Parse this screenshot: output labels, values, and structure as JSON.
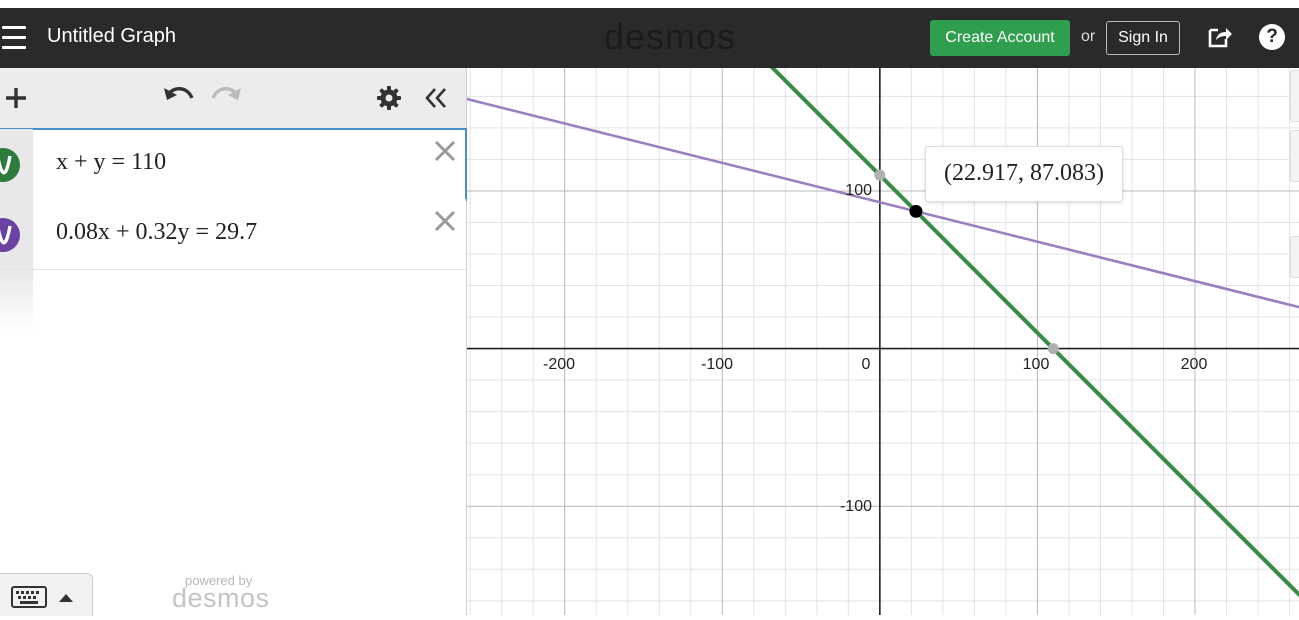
{
  "header": {
    "title": "Untitled Graph",
    "logo": "desmos",
    "create_account": "Create Account",
    "or": "or",
    "sign_in": "Sign In",
    "help": "?"
  },
  "expressions": [
    {
      "latex_display": "x + y = 110",
      "color": "#2d7c3e"
    },
    {
      "latex_display": "0.08x + 0.32y = 29.7",
      "color": "#6b42a3"
    }
  ],
  "footer": {
    "powered_by": "powered by",
    "logo": "desmos"
  },
  "graph": {
    "x_ticks": [
      "-200",
      "-100",
      "0",
      "100",
      "200"
    ],
    "y_ticks": [
      "100",
      "-100"
    ],
    "point_label": "(22.917, 87.083)"
  },
  "chart_data": {
    "type": "line",
    "xlim": [
      -262,
      266
    ],
    "ylim": [
      -169,
      178
    ],
    "grid": true,
    "series": [
      {
        "equation": "x + y = 110",
        "color": "#388c46",
        "a": 1,
        "b": 1,
        "c": 110
      },
      {
        "equation": "0.08x + 0.32y = 29.7",
        "color": "#9b7fc1",
        "a": 0.08,
        "b": 0.32,
        "c": 29.7
      }
    ],
    "points": [
      {
        "x": 22.917,
        "y": 87.083,
        "color": "#000000",
        "label": "(22.917, 87.083)"
      },
      {
        "x": 0,
        "y": 110,
        "color": "#b0b0b0"
      },
      {
        "x": 110,
        "y": 0,
        "color": "#b0b0b0"
      }
    ]
  }
}
